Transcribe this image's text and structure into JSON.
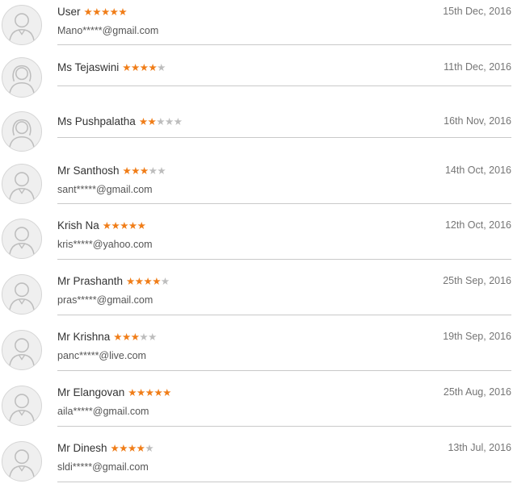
{
  "reviews": [
    {
      "name": "User",
      "rating": 5,
      "date": "15th Dec, 2016",
      "email": "Mano*****@gmail.com",
      "avatar": "male-avatar-icon"
    },
    {
      "name": "Ms Tejaswini",
      "rating": 4,
      "date": "11th Dec, 2016",
      "email": "",
      "avatar": "female-avatar-icon"
    },
    {
      "name": "Ms Pushpalatha",
      "rating": 2,
      "date": "16th Nov, 2016",
      "email": "",
      "avatar": "female-avatar-icon"
    },
    {
      "name": "Mr Santhosh",
      "rating": 3,
      "date": "14th Oct, 2016",
      "email": "sant*****@gmail.com",
      "avatar": "male-avatar-icon"
    },
    {
      "name": "Krish Na",
      "rating": 5,
      "date": "12th Oct, 2016",
      "email": "kris*****@yahoo.com",
      "avatar": "male-avatar-icon"
    },
    {
      "name": "Mr Prashanth",
      "rating": 4,
      "date": "25th Sep, 2016",
      "email": "pras*****@gmail.com",
      "avatar": "male-avatar-icon"
    },
    {
      "name": "Mr Krishna",
      "rating": 3,
      "date": "19th Sep, 2016",
      "email": "panc*****@live.com",
      "avatar": "male-avatar-icon"
    },
    {
      "name": "Mr Elangovan",
      "rating": 5,
      "date": "25th Aug, 2016",
      "email": "aila*****@gmail.com",
      "avatar": "male-avatar-icon"
    },
    {
      "name": "Mr Dinesh",
      "rating": 4,
      "date": "13th Jul, 2016",
      "email": "sldi*****@gmail.com",
      "avatar": "male-avatar-icon"
    }
  ],
  "max_rating": 5,
  "colors": {
    "star_filled": "#f07d18",
    "star_empty": "#bdbdbd",
    "divider": "#c9c9c9"
  }
}
